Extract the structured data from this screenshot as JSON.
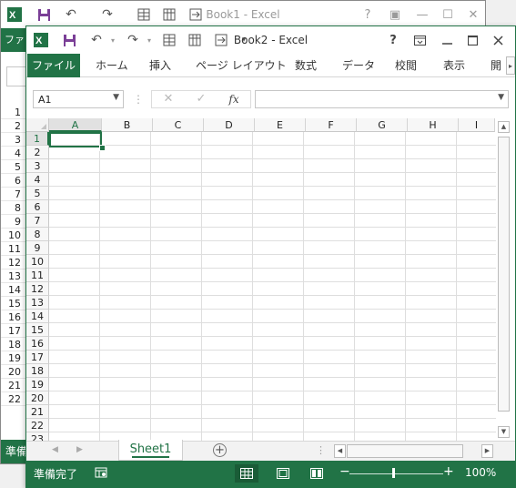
{
  "colors": {
    "accent": "#217346",
    "brand": "#217346"
  },
  "background_window": {
    "title": "Book1 - Excel",
    "file_tab_partial": "ファイ",
    "status_partial": "準備",
    "rows": [
      "1",
      "2",
      "3",
      "4",
      "5",
      "6",
      "7",
      "8",
      "9",
      "10",
      "11",
      "12",
      "13",
      "14",
      "15",
      "16",
      "17",
      "18",
      "19",
      "20",
      "21",
      "22"
    ]
  },
  "window": {
    "title": "Book2 - Excel",
    "help_label": "?",
    "icons": [
      "excel-logo-icon",
      "save-icon",
      "undo-icon",
      "redo-icon",
      "table-icon",
      "form-icon",
      "import-icon",
      "customize-qat-icon"
    ]
  },
  "ribbon": {
    "tabs": [
      "ファイル",
      "ホーム",
      "挿入",
      "ページ レイアウト",
      "数式",
      "データ",
      "校閲",
      "表示",
      "開"
    ]
  },
  "formula_bar": {
    "name_box": "A1",
    "fx_label": "fx",
    "formula_value": ""
  },
  "grid": {
    "columns": [
      "A",
      "B",
      "C",
      "D",
      "E",
      "F",
      "G",
      "H",
      "I"
    ],
    "rows": [
      "1",
      "2",
      "3",
      "4",
      "5",
      "6",
      "7",
      "8",
      "9",
      "10",
      "11",
      "12",
      "13",
      "14",
      "15",
      "16",
      "17",
      "18",
      "19",
      "20",
      "21",
      "22",
      "23"
    ],
    "active_cell": "A1"
  },
  "sheets": {
    "tabs": [
      "Sheet1"
    ],
    "active": "Sheet1"
  },
  "status": {
    "text": "準備完了",
    "zoom": "100%",
    "zoom_level": 1.0,
    "active_view": "normal"
  }
}
